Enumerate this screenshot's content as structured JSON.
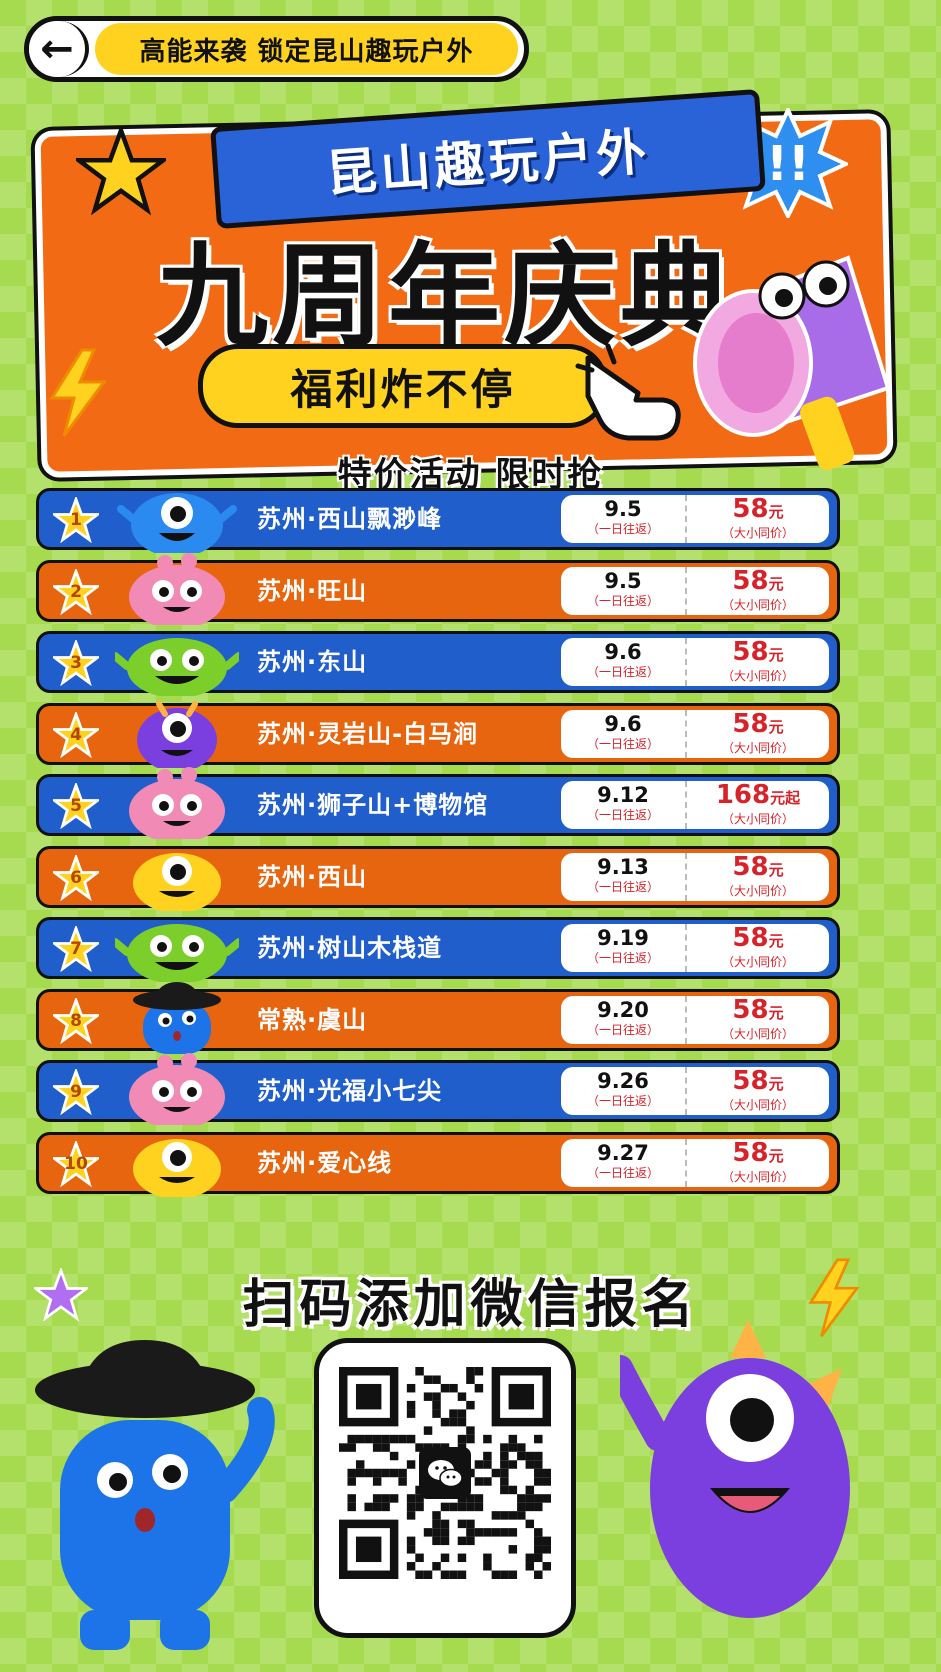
{
  "header": {
    "back_icon": "arrow-left-icon",
    "title": "高能来袭 锁定昆山趣玩户外"
  },
  "banner": {
    "ribbon_text": "昆山趣玩户外",
    "main_title": "九周年庆典",
    "pill_text": "福利炸不停"
  },
  "subheading": "特价活动 限时抢",
  "colors": {
    "blue": "#1f5ecb",
    "orange": "#e8650f",
    "yellow": "#ffd21f",
    "price_red": "#d8222a",
    "background": "#a6db4f"
  },
  "trips": [
    {
      "num": "1",
      "destination": "苏州·西山飘渺峰",
      "date": "9.5",
      "date_note": "（一日往返）",
      "price": "58",
      "price_unit": "元",
      "price_note": "（大小同价）",
      "color": "blue",
      "mascot": "blue-cyclops"
    },
    {
      "num": "2",
      "destination": "苏州·旺山",
      "date": "9.5",
      "date_note": "（一日往返）",
      "price": "58",
      "price_unit": "元",
      "price_note": "（大小同价）",
      "color": "orange",
      "mascot": "pink-fluffy"
    },
    {
      "num": "3",
      "destination": "苏州·东山",
      "date": "9.6",
      "date_note": "（一日往返）",
      "price": "58",
      "price_unit": "元",
      "price_note": "（大小同价）",
      "color": "blue",
      "mascot": "green-monster"
    },
    {
      "num": "4",
      "destination": "苏州·灵岩山-白马涧",
      "date": "9.6",
      "date_note": "（一日往返）",
      "price": "58",
      "price_unit": "元",
      "price_note": "（大小同价）",
      "color": "orange",
      "mascot": "purple-cyclops"
    },
    {
      "num": "5",
      "destination": "苏州·狮子山+博物馆",
      "date": "9.12",
      "date_note": "（一日往返）",
      "price": "168",
      "price_unit": "元起",
      "price_note": "（大小同价）",
      "color": "blue",
      "mascot": "pink-fluffy"
    },
    {
      "num": "6",
      "destination": "苏州·西山",
      "date": "9.13",
      "date_note": "（一日往返）",
      "price": "58",
      "price_unit": "元",
      "price_note": "（大小同价）",
      "color": "orange",
      "mascot": "yellow-cyclops"
    },
    {
      "num": "7",
      "destination": "苏州·树山木栈道",
      "date": "9.19",
      "date_note": "（一日往返）",
      "price": "58",
      "price_unit": "元",
      "price_note": "（大小同价）",
      "color": "blue",
      "mascot": "green-monster"
    },
    {
      "num": "8",
      "destination": "常熟·虞山",
      "date": "9.20",
      "date_note": "（一日往返）",
      "price": "58",
      "price_unit": "元",
      "price_note": "（大小同价）",
      "color": "orange",
      "mascot": "blue-hat"
    },
    {
      "num": "9",
      "destination": "苏州·光福小七尖",
      "date": "9.26",
      "date_note": "（一日往返）",
      "price": "58",
      "price_unit": "元",
      "price_note": "（大小同价）",
      "color": "blue",
      "mascot": "pink-fluffy"
    },
    {
      "num": "10",
      "destination": "苏州·爱心线",
      "date": "9.27",
      "date_note": "（一日往返）",
      "price": "58",
      "price_unit": "元",
      "price_note": "（大小同价）",
      "color": "orange",
      "mascot": "yellow-cyclops"
    }
  ],
  "cta": {
    "text": "扫码添加微信报名",
    "qr_icon": "qr-code-icon",
    "wechat_icon": "wechat-icon"
  }
}
